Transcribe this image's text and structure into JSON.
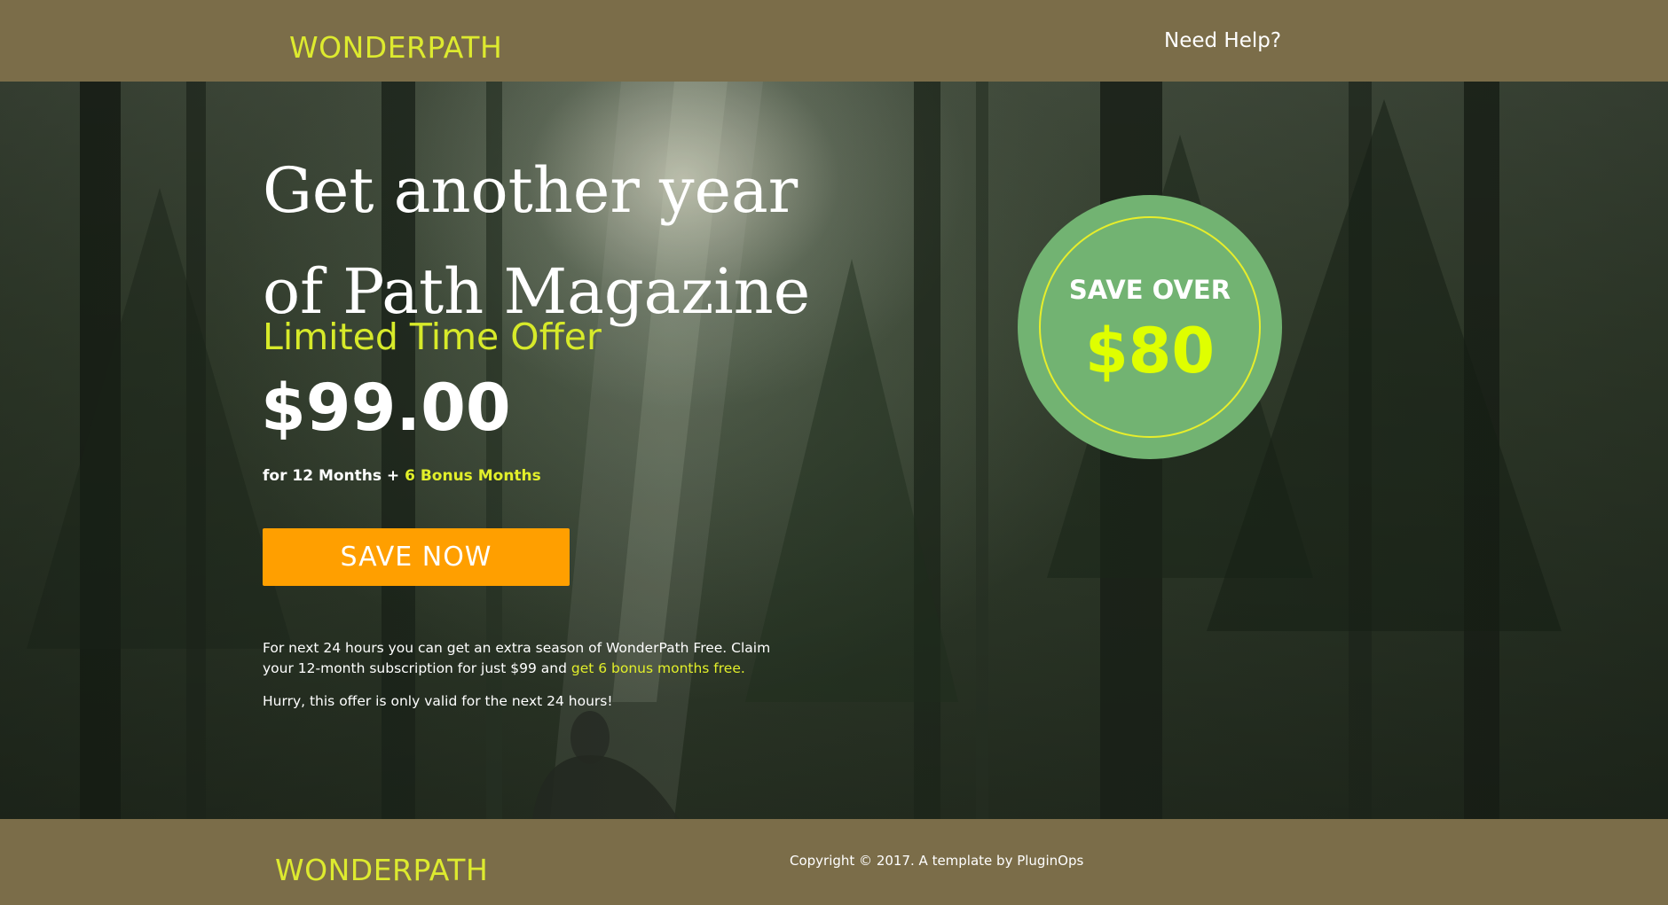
{
  "header": {
    "brand": "WONDERPATH",
    "help_link": "Need Help?"
  },
  "hero": {
    "headline": "Get another year of Path Magazine",
    "subhead": "Limited Time Offer",
    "price": "$99.00",
    "terms_prefix": "for 12 Months + ",
    "terms_bonus": "6 Bonus Months",
    "cta_label": "SAVE NOW",
    "description_part1": "For next 24 hours you can get an extra season of WonderPath Free. Claim your 12-month subscription for just $99 and ",
    "description_highlight": "get 6 bonus months free.",
    "urgency": "Hurry, this offer is only valid for the next 24 hours!"
  },
  "badge": {
    "label": "SAVE OVER",
    "amount": "$80"
  },
  "footer": {
    "brand": "WONDERPATH",
    "copyright": "Copyright © 2017. A template by PluginOps"
  },
  "colors": {
    "header_bg": "#7b6d49",
    "brand": "#ddea2f",
    "accent_yellow": "#e2ef2a",
    "cta": "#ff9f00",
    "badge_bg": "#72b372",
    "badge_amount": "#dfff00"
  },
  "icons": {
    "hero_background": "forest-photo"
  }
}
